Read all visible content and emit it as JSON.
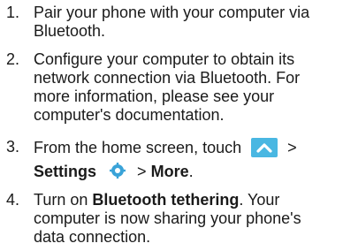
{
  "steps": [
    {
      "number": "1.",
      "lines": [
        "Pair your phone with your computer via",
        "Bluetooth."
      ]
    },
    {
      "number": "2.",
      "lines": [
        "Configure your computer to obtain its",
        "network connection via Bluetooth. For",
        "more information, please see your",
        "computer's documentation."
      ]
    },
    {
      "number": "3.",
      "line1": "From the home screen, touch",
      "sep1": ">",
      "settings": "Settings",
      "sep2": ">",
      "more": "More",
      "period": "."
    },
    {
      "number": "4.",
      "turn_on": "Turn on ",
      "bt_tethering": "Bluetooth tethering",
      "rest1": ". Your",
      "lines": [
        "computer is now sharing your phone's",
        "data connection."
      ]
    }
  ],
  "icons": {
    "home_button": "chevron-up-icon",
    "settings": "settings-gear-icon",
    "home_button_color": "#49b7e2",
    "settings_color": "#3aa3d8"
  }
}
